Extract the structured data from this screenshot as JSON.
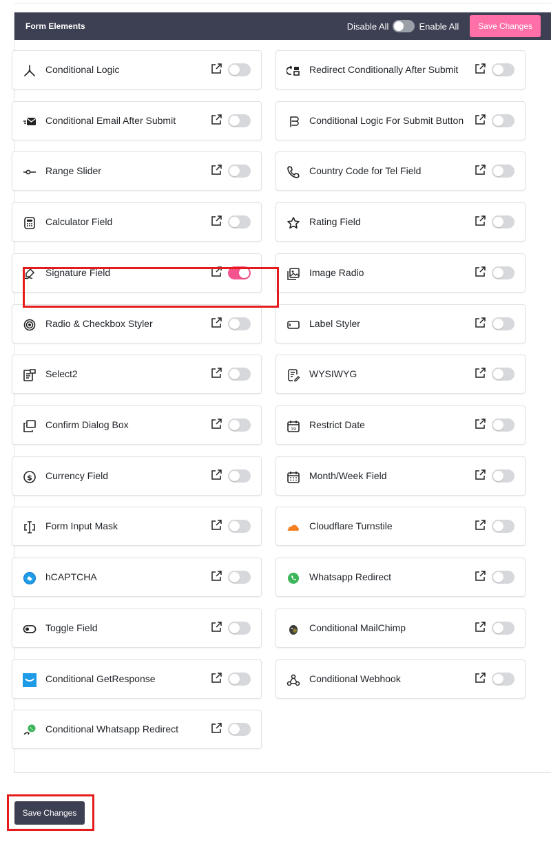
{
  "header": {
    "title": "Form Elements",
    "disable_all": "Disable All",
    "enable_all": "Enable All",
    "save_label": "Save Changes"
  },
  "colors": {
    "header_bg": "#3d3f52",
    "accent_pink": "#ff6fa8",
    "toggle_on": "#f5538d",
    "highlight": "#e51b1b"
  },
  "elements": [
    {
      "label": "Conditional Logic",
      "icon": "branch-icon",
      "enabled": false
    },
    {
      "label": "Redirect Conditionally After Submit",
      "icon": "redirect-icon",
      "enabled": false
    },
    {
      "label": "Conditional Email After Submit",
      "icon": "email-send-icon",
      "enabled": false
    },
    {
      "label": "Conditional Logic For Submit Button",
      "icon": "submit-button-icon",
      "enabled": false
    },
    {
      "label": "Range Slider",
      "icon": "slider-icon",
      "enabled": false
    },
    {
      "label": "Country Code for Tel Field",
      "icon": "phone-icon",
      "enabled": false
    },
    {
      "label": "Calculator Field",
      "icon": "calculator-icon",
      "enabled": false
    },
    {
      "label": "Rating Field",
      "icon": "star-icon",
      "enabled": false
    },
    {
      "label": "Signature Field",
      "icon": "signature-icon",
      "enabled": true
    },
    {
      "label": "Image Radio",
      "icon": "image-icon",
      "enabled": false
    },
    {
      "label": "Radio & Checkbox Styler",
      "icon": "radio-icon",
      "enabled": false
    },
    {
      "label": "Label Styler",
      "icon": "label-icon",
      "enabled": false
    },
    {
      "label": "Select2",
      "icon": "select-icon",
      "enabled": false
    },
    {
      "label": "WYSIWYG",
      "icon": "editor-icon",
      "enabled": false
    },
    {
      "label": "Confirm Dialog Box",
      "icon": "dialog-icon",
      "enabled": false
    },
    {
      "label": "Restrict Date",
      "icon": "calendar-icon",
      "enabled": false
    },
    {
      "label": "Currency Field",
      "icon": "dollar-icon",
      "enabled": false
    },
    {
      "label": "Month/Week Field",
      "icon": "calendar-grid-icon",
      "enabled": false
    },
    {
      "label": "Form Input Mask",
      "icon": "input-mask-icon",
      "enabled": false
    },
    {
      "label": "Cloudflare Turnstile",
      "icon": "cloudflare-icon",
      "enabled": false
    },
    {
      "label": "hCAPTCHA",
      "icon": "hcaptcha-icon",
      "enabled": false
    },
    {
      "label": "Whatsapp Redirect",
      "icon": "whatsapp-icon",
      "enabled": false
    },
    {
      "label": "Toggle Field",
      "icon": "toggle-icon",
      "enabled": false
    },
    {
      "label": "Conditional MailChimp",
      "icon": "mailchimp-icon",
      "enabled": false
    },
    {
      "label": "Conditional GetResponse",
      "icon": "getresponse-icon",
      "enabled": false
    },
    {
      "label": "Conditional Webhook",
      "icon": "webhook-icon",
      "enabled": false
    },
    {
      "label": "Conditional Whatsapp Redirect",
      "icon": "whatsapp-redirect-icon",
      "enabled": false
    }
  ],
  "footer": {
    "save_label": "Save Changes"
  }
}
